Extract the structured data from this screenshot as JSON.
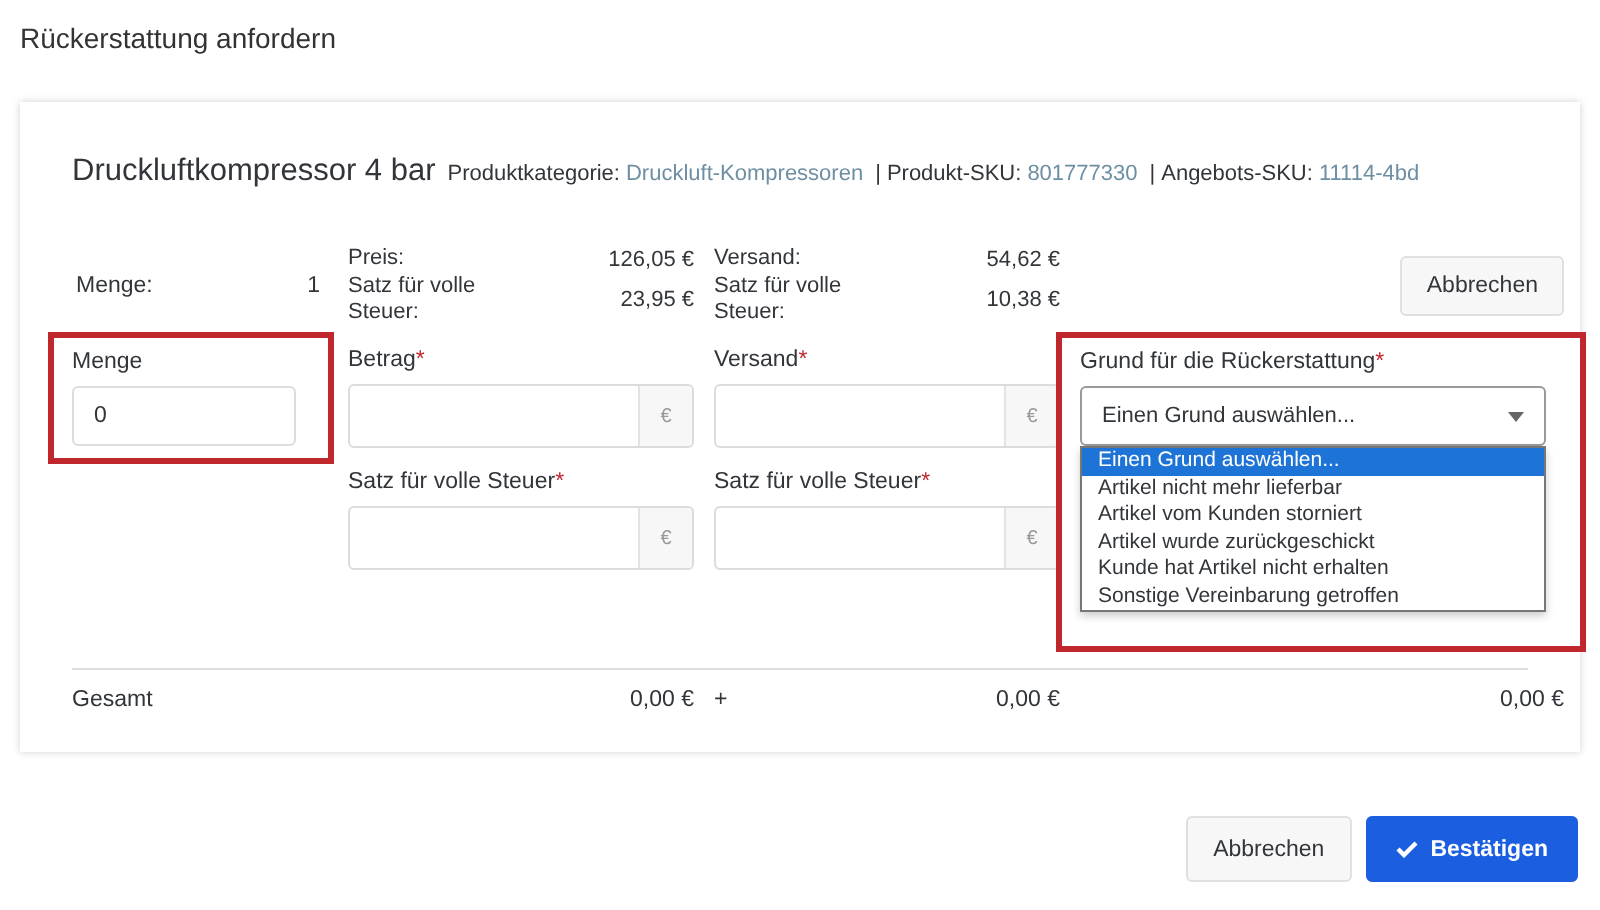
{
  "dialog_title": "Rückerstattung anfordern",
  "required_mark": "*",
  "product": {
    "name": "Druckluftkompressor 4 bar",
    "separator": "|",
    "meta": [
      {
        "label": "Produktkategorie:",
        "value": "Druckluft-Kompressoren"
      },
      {
        "label": "Produkt-SKU:",
        "value": "801777330"
      },
      {
        "label": "Angebots-SKU:",
        "value": "11114-4bd"
      }
    ]
  },
  "summary": {
    "quantity_label": "Menge:",
    "quantity_value": "1",
    "columns": [
      [
        {
          "label": "Preis:",
          "value": "126,05 €"
        },
        {
          "label": "Satz für volle Steuer:",
          "value": "23,95 €"
        }
      ],
      [
        {
          "label": "Versand:",
          "value": "54,62 €"
        },
        {
          "label": "Satz für volle Steuer:",
          "value": "10,38 €"
        }
      ]
    ],
    "cancel_button": "Abbrechen"
  },
  "quantity_field": {
    "label": "Menge",
    "value": "0",
    "highlighted": true
  },
  "amount_columns": [
    [
      {
        "label": "Betrag",
        "required": true,
        "unit": "€"
      },
      {
        "label": "Satz für volle Steuer",
        "required": true,
        "unit": "€"
      }
    ],
    [
      {
        "label": "Versand",
        "required": true,
        "unit": "€"
      },
      {
        "label": "Satz für volle Steuer",
        "required": true,
        "unit": "€"
      }
    ]
  ],
  "reason": {
    "label": "Grund für die Rückerstattung",
    "required": true,
    "value": "Einen Grund auswählen...",
    "highlighted": true,
    "expanded": true,
    "options": [
      {
        "label": "Einen Grund auswählen...",
        "selected": true
      },
      {
        "label": "Artikel nicht mehr lieferbar",
        "selected": false
      },
      {
        "label": "Artikel vom Kunden storniert",
        "selected": false
      },
      {
        "label": "Artikel wurde zurückgeschickt",
        "selected": false
      },
      {
        "label": "Kunde hat Artikel nicht erhalten",
        "selected": false
      },
      {
        "label": "Sonstige Vereinbarung getroffen",
        "selected": false
      }
    ]
  },
  "total": {
    "label": "Gesamt",
    "values": [
      "0,00 €",
      "0,00 €",
      "0,00 €"
    ],
    "operator": "+"
  },
  "footer": {
    "cancel": "Abbrechen",
    "confirm": "Bestätigen"
  }
}
